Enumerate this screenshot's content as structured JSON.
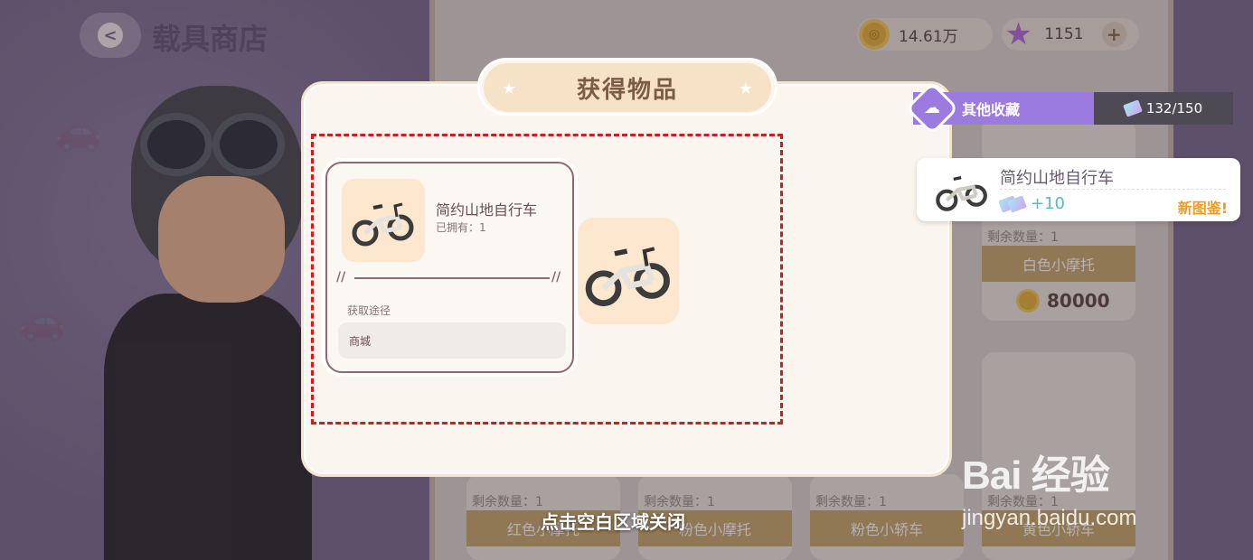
{
  "header": {
    "shop_title": "载具商店",
    "coins": "14.61万",
    "stars": "1151"
  },
  "shop": {
    "cards": [
      {
        "remain": "剩余数量：1",
        "name": "白色小摩托",
        "price": "80000"
      },
      {
        "remain": "剩余数量：1",
        "name": "红色小摩托"
      },
      {
        "remain": "剩余数量：1",
        "name": "粉色小摩托"
      },
      {
        "remain": "剩余数量：1",
        "name": "粉色小轿车"
      },
      {
        "remain": "剩余数量：1",
        "name": "黄色小轿车"
      }
    ]
  },
  "dialog": {
    "title": "获得物品",
    "item_name": "简约山地自行车",
    "owned": "已拥有：1",
    "source_label": "获取途径",
    "source_value": "商城"
  },
  "collection": {
    "label": "其他收藏",
    "progress": "132/150"
  },
  "toast": {
    "item_name": "简约山地自行车",
    "bonus": "+10",
    "new_label": "新图鉴!"
  },
  "close_hint": "点击空白区域关闭",
  "watermark": {
    "logo": "Bai 经验",
    "url": "jingyan.baidu.com"
  },
  "colors": {
    "accent_purple": "#9b7be0",
    "highlight_red": "#d01c1c",
    "title_tab": "#f6e2c6",
    "new_orange": "#f09a2a"
  }
}
